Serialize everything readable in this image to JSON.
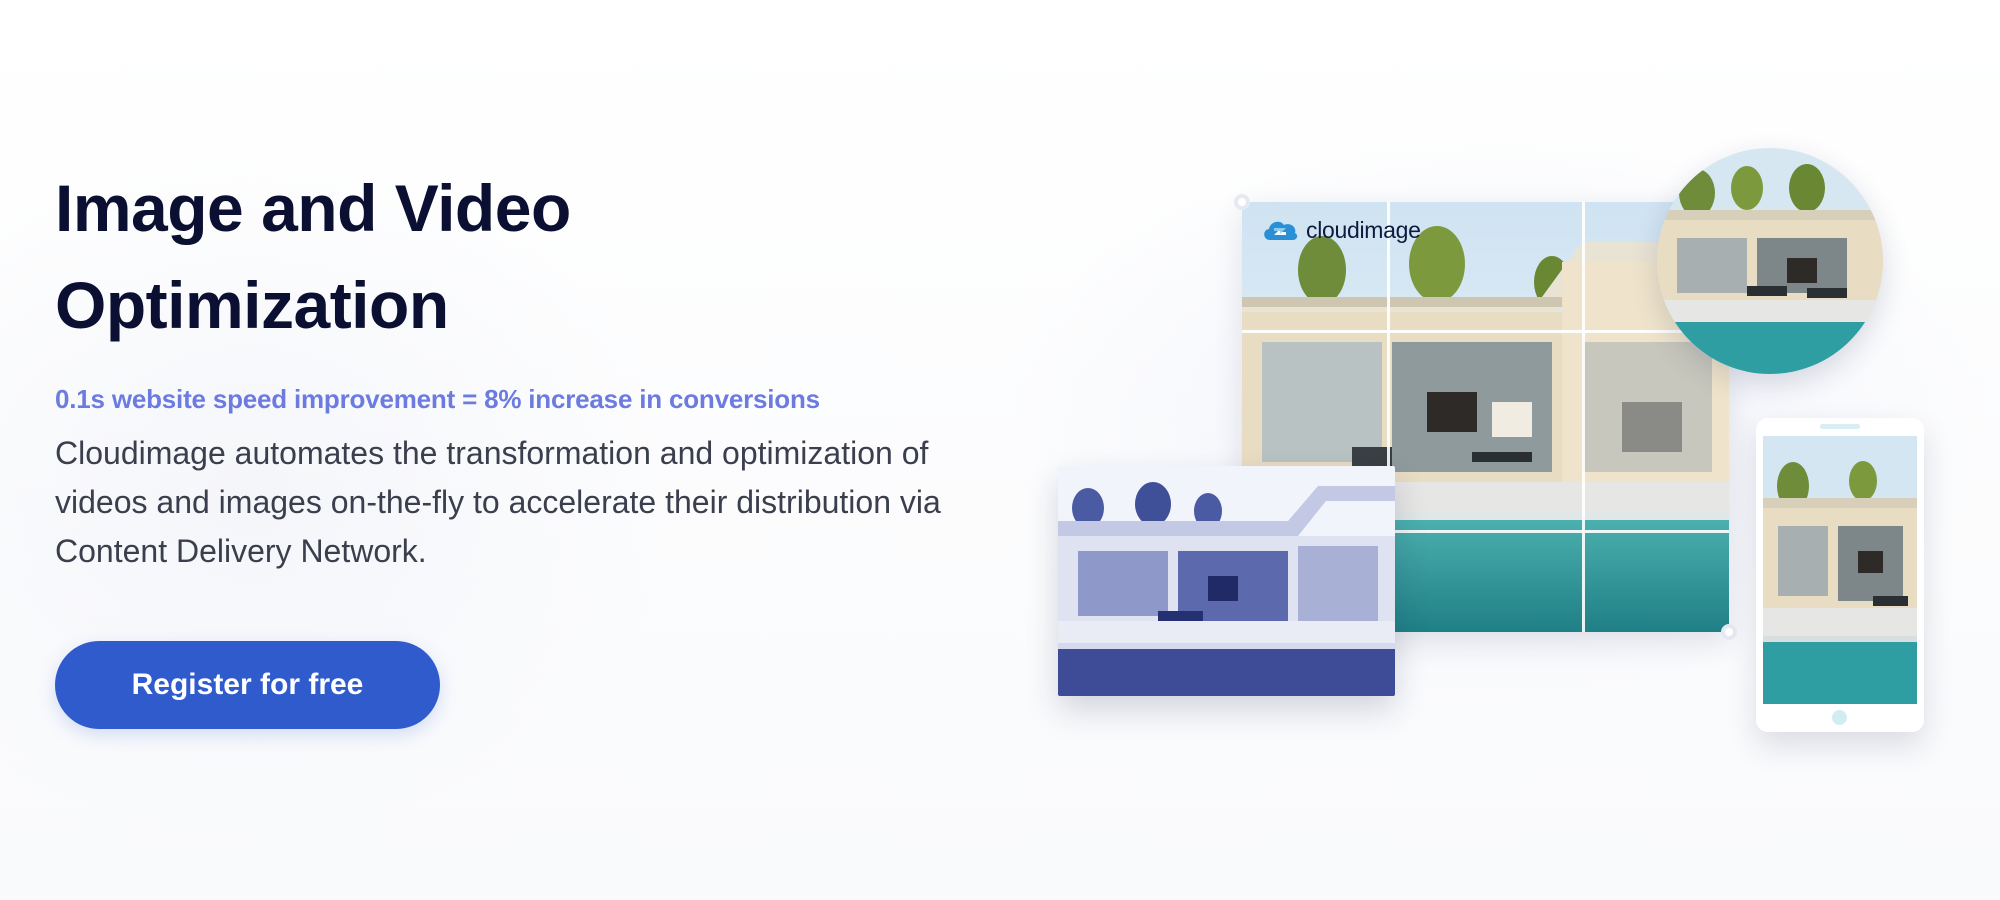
{
  "hero": {
    "title": "Image and Video Optimization",
    "tagline": "0.1s website speed improvement = 8% increase in conversions",
    "description": "Cloudimage automates the transformation and optimization of videos and images on-the-fly to accelerate their distribution via Content Delivery Network.",
    "cta_label": "Register for free"
  },
  "illustration": {
    "brand_name": "cloudimage",
    "brand_icon": "cloud-arrows-icon"
  },
  "colors": {
    "title": "#0b1033",
    "tagline": "#6c7be0",
    "body_text": "#3b3f4d",
    "cta_background": "#2f5bcc",
    "cta_text": "#ffffff",
    "brand_blue": "#2b8fd6",
    "pool": "#2f9ea3"
  }
}
